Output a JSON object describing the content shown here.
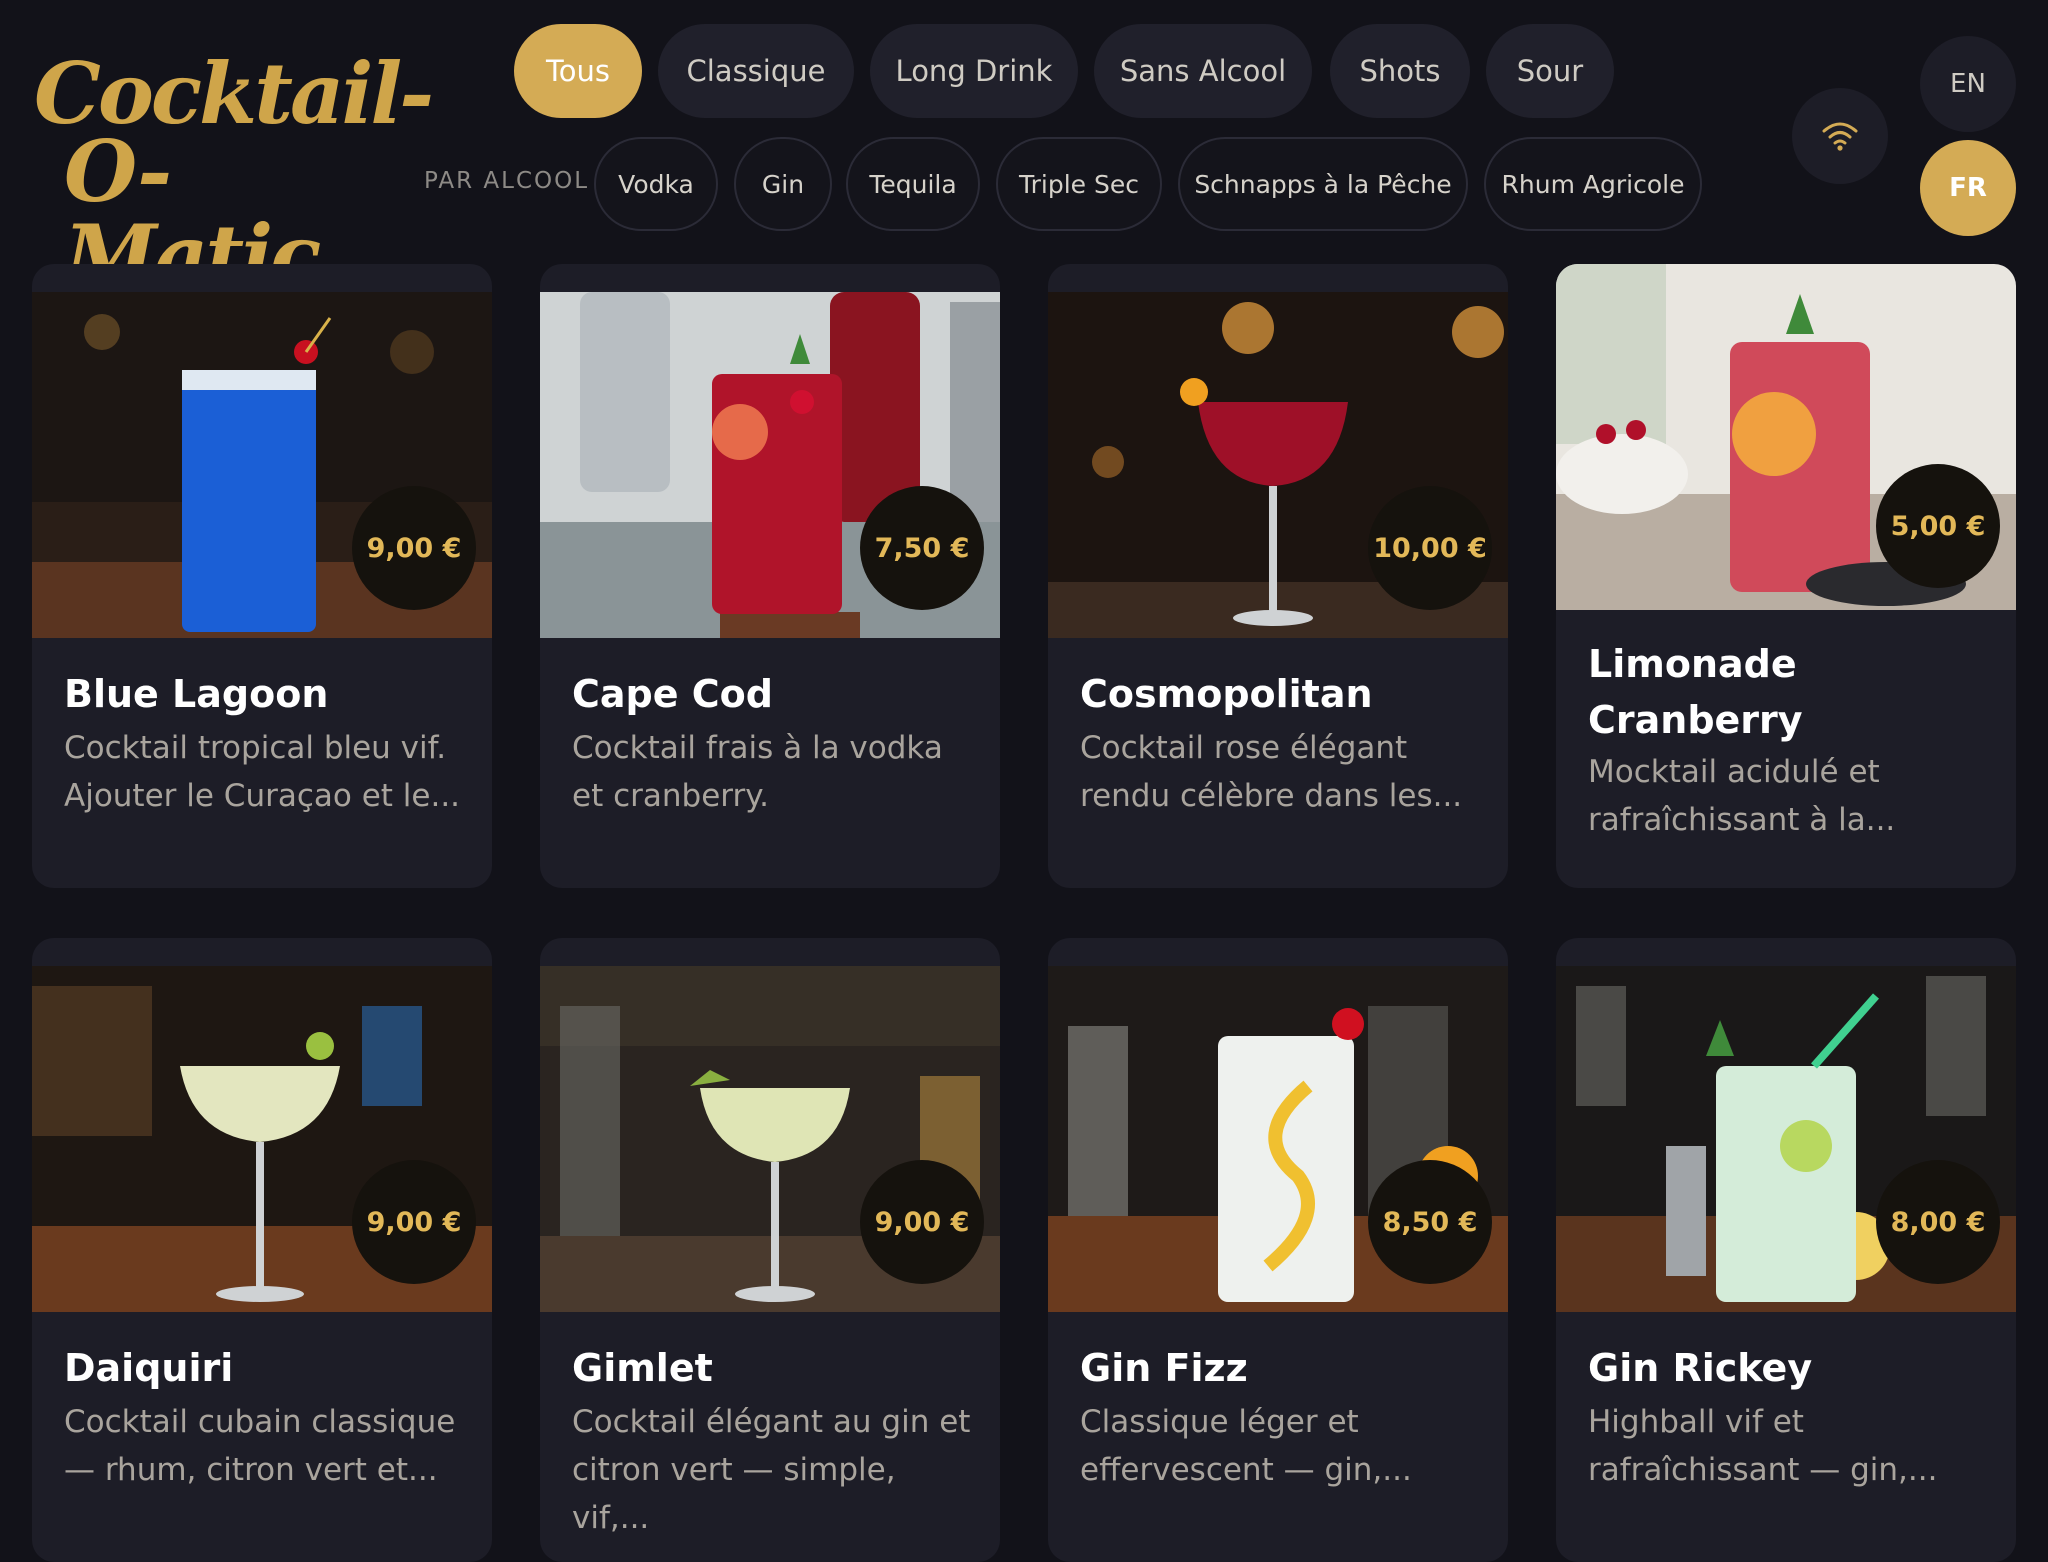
{
  "logo": {
    "line1": "Cocktail-",
    "line2": "O-Matic"
  },
  "categories": [
    {
      "label": "Tous",
      "active": true
    },
    {
      "label": "Classique"
    },
    {
      "label": "Long Drink"
    },
    {
      "label": "Sans Alcool"
    },
    {
      "label": "Shots"
    },
    {
      "label": "Sour"
    }
  ],
  "alcool_filter": {
    "label": "PAR ALCOOL",
    "options": [
      "Vodka",
      "Gin",
      "Tequila",
      "Triple Sec",
      "Schnapps à la Pêche",
      "Rhum Agricole"
    ]
  },
  "status": {
    "icon": "wifi-icon"
  },
  "languages": [
    {
      "code": "EN"
    },
    {
      "code": "FR",
      "active": true
    }
  ],
  "colors": {
    "accent": "#d4ab55",
    "background": "#121219",
    "card": "#1d1d27"
  },
  "cocktails": [
    {
      "name": "Blue Lagoon",
      "price": "9,00 €",
      "description": "Cocktail tropical bleu vif. Ajouter le Curaçao et le...",
      "drink_color": "#1b5fd6"
    },
    {
      "name": "Cape Cod",
      "price": "7,50 €",
      "description": "Cocktail frais à la vodka et cranberry.",
      "drink_color": "#b0142a"
    },
    {
      "name": "Cosmopolitan",
      "price": "10,00 €",
      "description": "Cocktail rose élégant rendu célèbre dans les...",
      "drink_color": "#9e1028"
    },
    {
      "name": "Limonade Cranberry",
      "price": "5,00 €",
      "description": "Mocktail acidulé et rafraîchissant à la...",
      "drink_color": "#d04a5a"
    },
    {
      "name": "Daiquiri",
      "price": "9,00 €",
      "description": "Cocktail cubain classique — rhum, citron vert et...",
      "drink_color": "#e3e6bf"
    },
    {
      "name": "Gimlet",
      "price": "9,00 €",
      "description": "Cocktail élégant au gin et citron vert — simple, vif,...",
      "drink_color": "#dfe5b5"
    },
    {
      "name": "Gin Fizz",
      "price": "8,50 €",
      "description": "Classique léger et effervescent — gin,...",
      "drink_color": "#eef1ee"
    },
    {
      "name": "Gin Rickey",
      "price": "8,00 €",
      "description": "Highball vif et rafraîchissant — gin,...",
      "drink_color": "#d4ecd9"
    }
  ]
}
